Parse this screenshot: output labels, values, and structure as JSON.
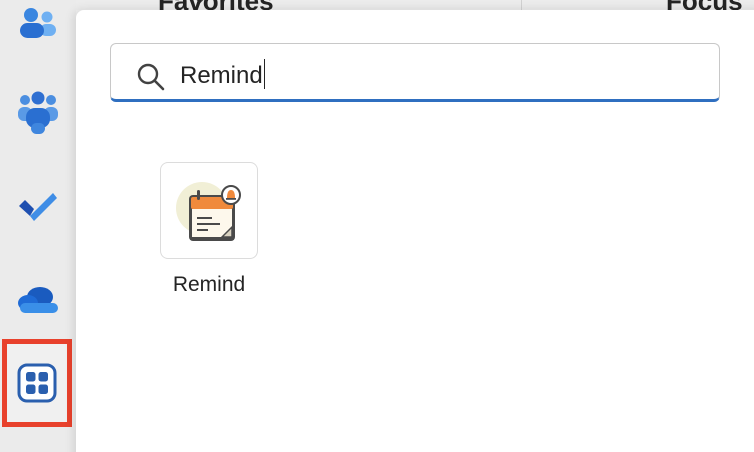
{
  "background": {
    "left_heading": "Favorites",
    "right_heading": "Focus"
  },
  "rail": {
    "items": [
      {
        "name": "people-icon"
      },
      {
        "name": "teams-icon"
      },
      {
        "name": "todo-check-icon"
      },
      {
        "name": "onedrive-cloud-icon"
      },
      {
        "name": "apps-grid-icon",
        "selected": true
      }
    ],
    "highlight_color": "#e8412c"
  },
  "search": {
    "value": "Remind",
    "accent_color": "#2f6fc0"
  },
  "results": [
    {
      "label": "Remind",
      "icon": "remind-calendar-bell-icon"
    }
  ]
}
